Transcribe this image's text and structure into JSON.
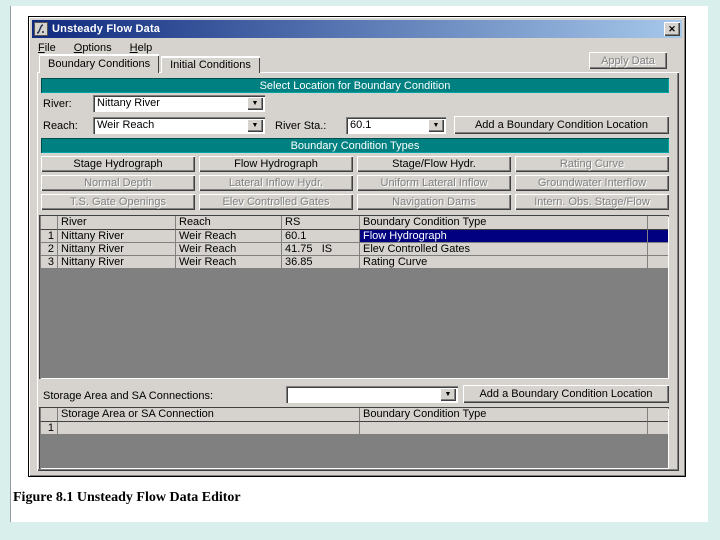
{
  "window": {
    "title": "Unsteady Flow Data",
    "close_glyph": "✕",
    "apply_label": "Apply Data"
  },
  "menu": {
    "items": [
      "File",
      "Options",
      "Help"
    ]
  },
  "tabs": [
    {
      "label": "Boundary Conditions",
      "active": true
    },
    {
      "label": "Initial Conditions",
      "active": false
    }
  ],
  "select_location": {
    "header": "Select Location for Boundary Condition",
    "river_label": "River:",
    "river_value": "Nittany River",
    "reach_label": "Reach:",
    "reach_value": "Weir Reach",
    "river_sta_label": "River Sta.:",
    "river_sta_value": "60.1",
    "add_button": "Add a Boundary Condition Location",
    "dropdown_glyph": "▼"
  },
  "bc_types": {
    "header": "Boundary Condition Types",
    "buttons": [
      {
        "label": "Stage Hydrograph",
        "enabled": true
      },
      {
        "label": "Flow Hydrograph",
        "enabled": true
      },
      {
        "label": "Stage/Flow Hydr.",
        "enabled": true
      },
      {
        "label": "Rating Curve",
        "enabled": false
      },
      {
        "label": "Normal Depth",
        "enabled": false
      },
      {
        "label": "Lateral Inflow Hydr.",
        "enabled": false
      },
      {
        "label": "Uniform Lateral Inflow",
        "enabled": false
      },
      {
        "label": "Groundwater Interflow",
        "enabled": false
      },
      {
        "label": "T.S. Gate Openings",
        "enabled": false
      },
      {
        "label": "Elev Controlled Gates",
        "enabled": false
      },
      {
        "label": "Navigation Dams",
        "enabled": false
      },
      {
        "label": "Intern. Obs. Stage/Flow",
        "enabled": false
      }
    ]
  },
  "bc_table": {
    "columns": [
      "",
      "River",
      "Reach",
      "RS",
      "Boundary Condition Type"
    ],
    "rows": [
      {
        "num": "1",
        "river": "Nittany River",
        "reach": "Weir Reach",
        "rs": "60.1",
        "type": "Flow Hydrograph",
        "selected": true
      },
      {
        "num": "2",
        "river": "Nittany River",
        "reach": "Weir Reach",
        "rs": "41.75   IS",
        "type": "Elev Controlled Gates",
        "selected": false
      },
      {
        "num": "3",
        "river": "Nittany River",
        "reach": "Weir Reach",
        "rs": "36.85",
        "type": "Rating Curve",
        "selected": false
      }
    ]
  },
  "storage": {
    "label": "Storage Area and SA Connections:",
    "combo_value": "",
    "add_button": "Add a Boundary Condition Location"
  },
  "sa_table": {
    "columns": [
      "",
      "Storage Area or SA Connection",
      "Boundary Condition Type"
    ],
    "rows": [
      {
        "num": "1",
        "name": "",
        "type": ""
      }
    ]
  },
  "caption": "Figure 8.1 Unsteady Flow Data Editor",
  "colors": {
    "teal_header": "#008080",
    "selection": "#000080",
    "dialog_face": "#d6d3ce",
    "table_background": "#808080",
    "titlebar_gradient_start": "#0f2a7e",
    "titlebar_gradient_end": "#a6c8ea",
    "page_background": "#d9efec"
  }
}
